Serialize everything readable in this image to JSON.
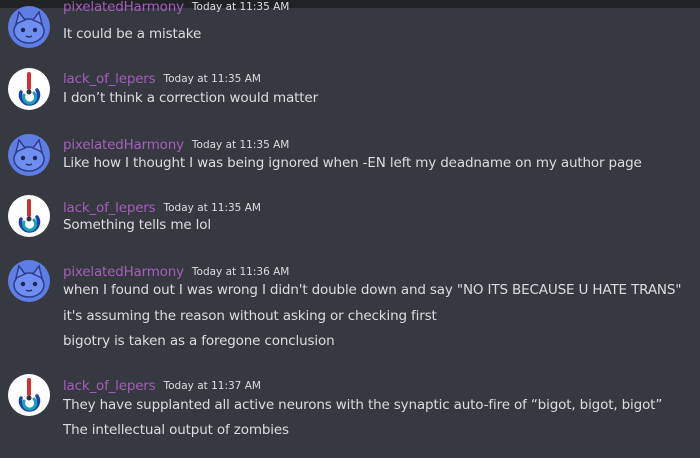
{
  "colors": {
    "background": "#36393f",
    "topbar": "#202225",
    "username": "#a45ebd",
    "text": "#dcddde",
    "cat_avatar_bg": "#5e7ee3",
    "lepers_avatar_bg": "#ffffff"
  },
  "messages": [
    {
      "user": "pixelatedHarmony",
      "timestamp": "Today at 11:35 AM",
      "avatar": "blue-cat-avatar",
      "lines": [
        "It could be a mistake"
      ]
    },
    {
      "user": "lack_of_lepers",
      "timestamp": "Today at 11:35 AM",
      "avatar": "tricolor-swirl-avatar",
      "lines": [
        "I don’t think a correction would matter"
      ]
    },
    {
      "user": "pixelatedHarmony",
      "timestamp": "Today at 11:35 AM",
      "avatar": "blue-cat-avatar",
      "lines": [
        "Like how I thought I was being ignored when -EN left my deadname on my author page"
      ]
    },
    {
      "user": "lack_of_lepers",
      "timestamp": "Today at 11:35 AM",
      "avatar": "tricolor-swirl-avatar",
      "lines": [
        "Something tells me lol"
      ]
    },
    {
      "user": "pixelatedHarmony",
      "timestamp": "Today at 11:36 AM",
      "avatar": "blue-cat-avatar",
      "lines": [
        "when I found out I was wrong I didn't double down and say \"NO ITS BECAUSE U HATE TRANS\"",
        "it's assuming the reason without asking or checking first",
        "bigotry is taken as a foregone conclusion"
      ]
    },
    {
      "user": "lack_of_lepers",
      "timestamp": "Today at 11:37 AM",
      "avatar": "tricolor-swirl-avatar",
      "lines": [
        "They have supplanted all active neurons with the synaptic auto-fire of “bigot, bigot, bigot”",
        "The intellectual output of zombies"
      ]
    }
  ]
}
